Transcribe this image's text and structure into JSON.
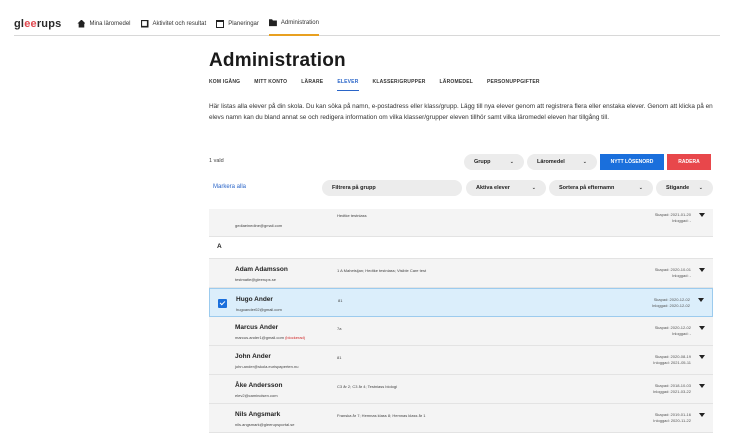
{
  "topnav": {
    "logo": "gleerups",
    "items": [
      {
        "label": "Mina läromedel",
        "icon": "home-icon"
      },
      {
        "label": "Aktivitet och resultat",
        "icon": "chart-icon"
      },
      {
        "label": "Planeringar",
        "icon": "calendar-icon"
      },
      {
        "label": "Administration",
        "icon": "folder-icon"
      }
    ]
  },
  "page": {
    "title": "Administration",
    "tabs": [
      "KOM IGÅNG",
      "MITT KONTO",
      "LÄRARE",
      "ELEVER",
      "KLASSER/GRUPPER",
      "LÄROMEDEL",
      "PERSONUPPGIFTER"
    ],
    "active_tab": "ELEVER",
    "description": "Här listas alla elever på din skola. Du kan söka på namn, e-postadress eller klass/grupp. Lägg till nya elever genom att registrera flera eller enstaka elever. Genom att klicka på en elevs namn kan du bland annat se och redigera information om vilka klasser/grupper eleven tillhör samt vilka läromedel eleven har tillgång till."
  },
  "toolbar": {
    "selected_count": "1 vald",
    "grupp": "Grupp",
    "laromedel": "Läromedel",
    "new_password": "NYTT LÖSENORD",
    "delete": "RADERA",
    "select_all": "Markera alla",
    "filter_group": "Filtrera på grupp",
    "active_students": "Aktiva elever",
    "sort": "Sortera på efternamn",
    "order": "Stigande",
    "chevron": "⌄"
  },
  "students": {
    "first": {
      "email": "gediaeinedine@gmail.com",
      "groups": "Hedtke testniass",
      "skapad": "Skapad: 2021-01-20",
      "inloggad": "Inloggad: -"
    },
    "section_a": "A",
    "rows": [
      {
        "name": "Adam Adamsson",
        "email": "testmatie@gleerups.se",
        "groups": "1 A Mahetsijan; Hedtke testniass; Visible Care test",
        "skapad": "Skapad: 2020-10-01",
        "inloggad": "Inloggad: -",
        "selected": false
      },
      {
        "name": "Hugo Ander",
        "email": "hugoander02@gmail.com",
        "groups": "81",
        "skapad": "Skapad: 2020-12-02",
        "inloggad": "Inloggad: 2020-12-02",
        "selected": true
      },
      {
        "name": "Marcus Ander",
        "email": "marcus.ander1@gmail.com",
        "blocked": "(blockerad)",
        "groups": "7a",
        "skapad": "Skapad: 2020-12-02",
        "inloggad": "Inloggad: -",
        "selected": false
      },
      {
        "name": "John Ander",
        "email": "john.ander@skola.eurispaperten.nu",
        "groups": "81",
        "skapad": "Skapad: 2020-08-19",
        "inloggad": "Inloggad: 2021-05-11",
        "selected": false
      },
      {
        "name": "Åke Andersson",
        "email": "elev2@caminolsen.com",
        "groups": "C3 år 2; C3 år 4; Testniass biologi",
        "skapad": "Skapad: 2018-10-03",
        "inloggad": "Inloggad: 2021-03-22",
        "selected": false
      },
      {
        "name": "Nils Angsmark",
        "email": "nils.angsmark@gleerupsportal.se",
        "groups": "Franska år 7; Hemnas klass 8; Hemnas klass år 1",
        "skapad": "Skapad: 2019-01-16",
        "inloggad": "Inloggad: 2020-11-22",
        "selected": false
      }
    ]
  }
}
